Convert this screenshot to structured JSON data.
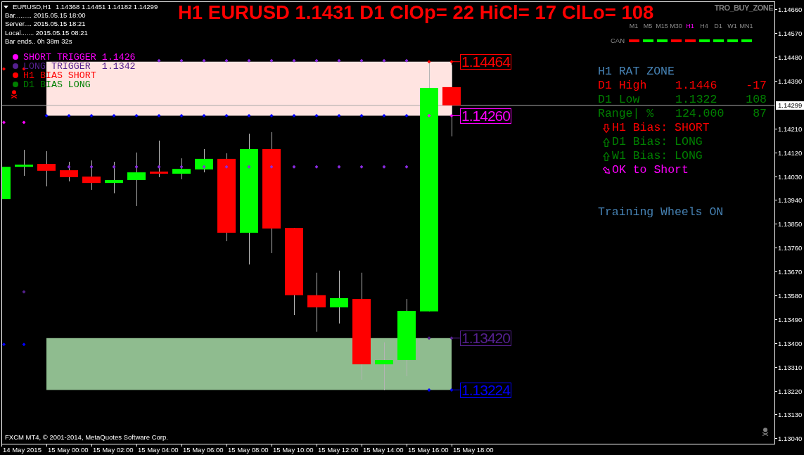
{
  "chart_header": {
    "symbol": "EURUSD,H1",
    "quotes": "1.14368 1.14451 1.14182 1.14299"
  },
  "info_lines": [
    "Bar......... 2015.05.15 18:00",
    "Server.... 2015.05.15 18:21",
    "Local....... 2015.05.15 08:21",
    "Bar ends.. 0h 38m 32s"
  ],
  "legend": [
    {
      "label": "SHORT TRIGGER 1.1426",
      "color": "#ff00ff"
    },
    {
      "label": "LONG TRIGGER  1.1342",
      "color": "#55208f"
    },
    {
      "label": "H1 BIAS SHORT",
      "color": "#ff0000"
    },
    {
      "label": "D1 BIAS LONG",
      "color": "#008000"
    }
  ],
  "headline": "H1 EURUSD 1.1431 D1 ClOp= 22 HiCl= 17 ClLo= 108",
  "indicator_name": "TRO_BUY_ZONE",
  "timeframes": [
    {
      "label": "M1",
      "selected": false
    },
    {
      "label": "M5",
      "selected": false
    },
    {
      "label": "M15",
      "selected": false
    },
    {
      "label": "M30",
      "selected": false
    },
    {
      "label": "H1",
      "selected": true
    },
    {
      "label": "H4",
      "selected": false
    },
    {
      "label": "D1",
      "selected": false
    },
    {
      "label": "W1",
      "selected": false
    },
    {
      "label": "MN1",
      "selected": false
    }
  ],
  "candle_signals": {
    "label": "CAN",
    "dashes": [
      {
        "color": "#ff0000"
      },
      {
        "color": "#00ff00"
      },
      {
        "color": "#00ff00"
      },
      {
        "color": "#ff0000"
      },
      {
        "color": "#ff0000"
      },
      {
        "color": "#00ff00"
      },
      {
        "color": "#00ff00"
      },
      {
        "color": "#00ff00"
      },
      {
        "color": "#00ff00"
      }
    ]
  },
  "rat_zone": {
    "title": "H1 RAT ZONE",
    "rows": [
      {
        "label": "D1 High",
        "value": "1.1446",
        "points": "-17",
        "color": "#ff0000"
      },
      {
        "label": "D1 Low",
        "value": "1.1322",
        "points": "108",
        "color": "#008000"
      },
      {
        "label": "Range| %",
        "value": "124.000",
        "points": "87",
        "color": "#008000"
      }
    ],
    "biases": [
      {
        "kind": "down",
        "text": "H1 Bias: SHORT",
        "color": "#ff0000"
      },
      {
        "kind": "up",
        "text": "D1 Bias: LONG",
        "color": "#008000"
      },
      {
        "kind": "up",
        "text": "W1 Bias: LONG",
        "color": "#008000"
      },
      {
        "kind": "diagonal",
        "text": "OK to Short",
        "color": "#ff00ff"
      }
    ],
    "status": "Training Wheels ON"
  },
  "chart": {
    "price_tags": [
      {
        "label": "1.14464",
        "color": "#ff0000"
      },
      {
        "label": "1.14260",
        "color": "#ff00ff"
      },
      {
        "label": "1.13420",
        "color": "#55208f"
      },
      {
        "label": "1.13224",
        "color": "#0000ff"
      }
    ],
    "price_scale": [
      "1.14660",
      "1.14570",
      "1.14480",
      "1.14390",
      "1.14210",
      "1.14120",
      "1.14030",
      "1.13940",
      "1.13850",
      "1.13760",
      "1.13670",
      "1.13580",
      "1.13490",
      "1.13400",
      "1.13310",
      "1.13220",
      "1.13130",
      "1.13040"
    ],
    "current_price": "1.14299",
    "time_scale": [
      "14 May 2015",
      "15 May 00:00",
      "15 May 02:00",
      "15 May 04:00",
      "15 May 06:00",
      "15 May 08:00",
      "15 May 10:00",
      "15 May 12:00",
      "15 May 14:00",
      "15 May 16:00",
      "15 May 18:00"
    ]
  },
  "copyright": "FXCM MT4, © 2001-2014, MetaQuotes Software Corp."
}
